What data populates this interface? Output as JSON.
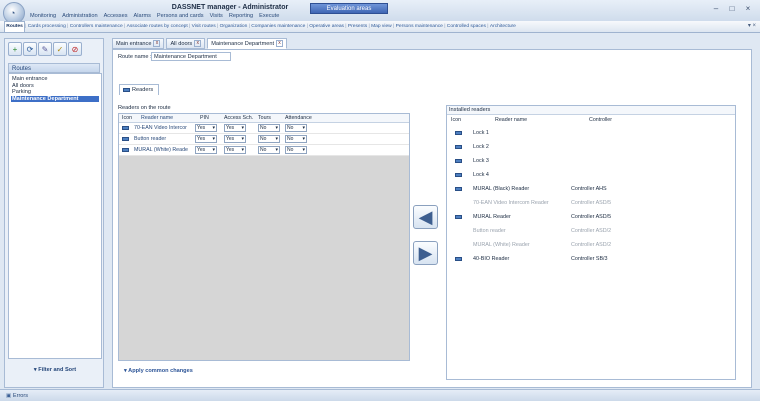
{
  "window": {
    "title": "DASSNET manager - Administrator",
    "badge": "Evaluation areas",
    "minimize": "–",
    "maximize": "□",
    "close": "×"
  },
  "menu": [
    "Monitoring",
    "Administration",
    "Accesses",
    "Alarms",
    "Persons and cards",
    "Visits",
    "Reporting",
    "Execute"
  ],
  "tabs": [
    "Routes",
    "Cards processing",
    "Controllers maintenance",
    "Associate routes by concept",
    "Visit routes",
    "Organization",
    "Companies maintenance",
    "Operative areas",
    "Presents",
    "Map view",
    "Persons maintenance",
    "Controlled spaces",
    "Architecture"
  ],
  "tabs_pin": "▾ ×",
  "left": {
    "toolbar": [
      "+",
      "⟳",
      "✎",
      "✓",
      "⊘"
    ],
    "routes_header": "Routes",
    "routes": [
      "Main entrance",
      "All doors",
      "Parking",
      "Maintenance Department"
    ],
    "filter_sort": "▾  Filter and Sort"
  },
  "doc_tabs": [
    "Main entrance",
    "All doors",
    "Maintenance Department"
  ],
  "doc_tab_close": "x",
  "route_name_label": "Route name :",
  "route_name_value": "Maintenance Department",
  "readers_tab": "Readers",
  "readers_on_route": {
    "title": "Readers on the route",
    "headers": {
      "icon": "Icon",
      "name": "Reader name",
      "pin": "PIN",
      "access": "Access Sch.",
      "tours": "Tours",
      "attendance": "Attendance"
    },
    "rows": [
      {
        "name": "70-EAN Video Intercor",
        "pin": "Yes",
        "access": "Yes",
        "tours": "No",
        "attendance": "No"
      },
      {
        "name": "Button reader",
        "pin": "Yes",
        "access": "Yes",
        "tours": "No",
        "attendance": "No"
      },
      {
        "name": "MURAL (White) Reade",
        "pin": "Yes",
        "access": "Yes",
        "tours": "No",
        "attendance": "No"
      }
    ]
  },
  "apply_changes": "▾  Apply common changes",
  "arrows": {
    "add": "◀",
    "remove": "▶"
  },
  "installed": {
    "title": "Installed readers",
    "headers": {
      "icon": "Icon",
      "name": "Reader name",
      "controller": "Controller"
    },
    "rows": [
      {
        "name": "Lock 1",
        "controller": "",
        "dim": false
      },
      {
        "name": "Lock 2",
        "controller": "",
        "dim": false
      },
      {
        "name": "Lock 3",
        "controller": "",
        "dim": false
      },
      {
        "name": "Lock 4",
        "controller": "",
        "dim": false
      },
      {
        "name": "MURAL (Black) Reader",
        "controller": "Controller AHS",
        "dim": false
      },
      {
        "name": "70-EAN Video Intercom Reader",
        "controller": "Controller ASD/5",
        "dim": true
      },
      {
        "name": "MURAL Reader",
        "controller": "Controller ASD/5",
        "dim": false
      },
      {
        "name": "Button reader",
        "controller": "Controller ASD/2",
        "dim": true
      },
      {
        "name": "MURAL (White) Reader",
        "controller": "Controller ASD/2",
        "dim": true
      },
      {
        "name": "40-BIO Reader",
        "controller": "Controller SB/3",
        "dim": false
      }
    ]
  },
  "status": {
    "errors": "Errors"
  }
}
